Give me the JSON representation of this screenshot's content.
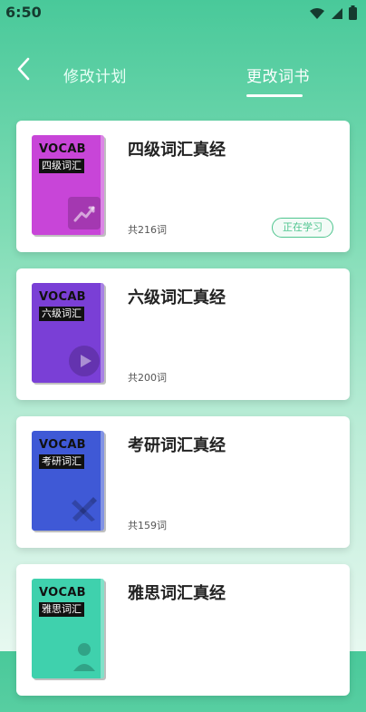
{
  "status": {
    "time": "6:50",
    "icons": [
      "wifi-icon",
      "signal-icon",
      "battery-icon"
    ]
  },
  "header": {
    "back_icon": "chevron-left-icon",
    "tabs": [
      {
        "label": "修改计划",
        "active": false
      },
      {
        "label": "更改词书",
        "active": true
      }
    ]
  },
  "books": [
    {
      "title": "四级词汇真经",
      "count": "共216词",
      "badge": "正在学习",
      "cover": {
        "brand": "VOCAB",
        "tag": "四级词汇",
        "color": "#c845d8",
        "icon": "trend-chart-icon"
      }
    },
    {
      "title": "六级词汇真经",
      "count": "共200词",
      "badge": "",
      "cover": {
        "brand": "VOCAB",
        "tag": "六级词汇",
        "color": "#7a3fd6",
        "icon": "play-icon"
      }
    },
    {
      "title": "考研词汇真经",
      "count": "共159词",
      "badge": "",
      "cover": {
        "brand": "VOCAB",
        "tag": "考研词汇",
        "color": "#3f59d6",
        "icon": "ruler-pencil-icon"
      }
    },
    {
      "title": "雅思词汇真经",
      "count": "",
      "badge": "",
      "cover": {
        "brand": "VOCAB",
        "tag": "雅思词汇",
        "color": "#3fd1ad",
        "icon": "person-icon"
      }
    }
  ],
  "colors": {
    "accent": "#4fc58f",
    "bg_top": "#49c99a"
  }
}
